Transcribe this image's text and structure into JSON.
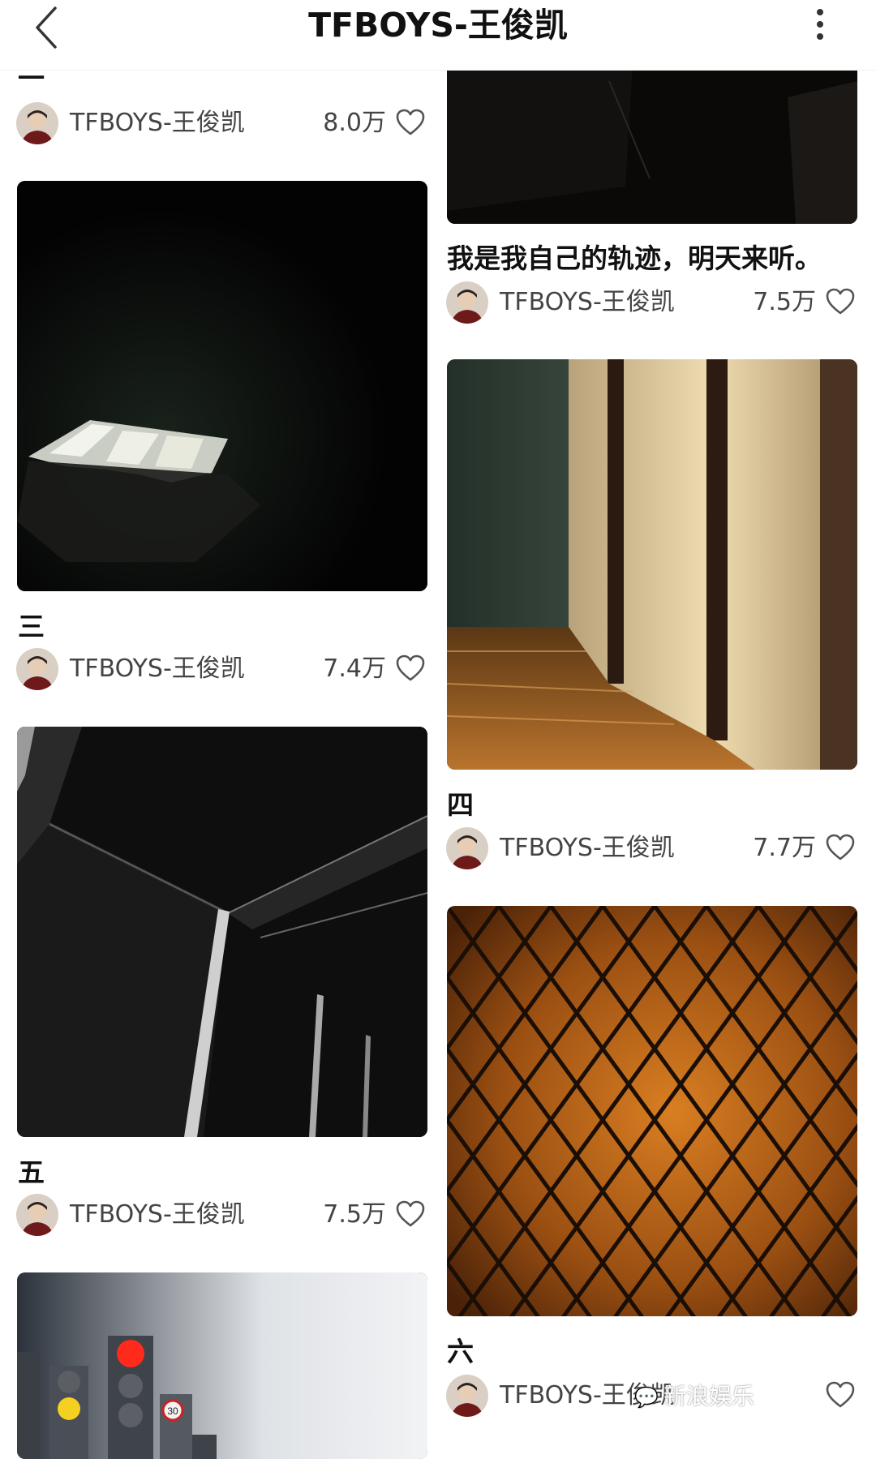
{
  "header": {
    "title": "TFBOYS-王俊凯"
  },
  "posts": [
    {
      "caption": "一",
      "author": "TFBOYS-王俊凯",
      "likes": "8.0万"
    },
    {
      "caption": "我是我自己的轨迹，明天来听。",
      "author": "TFBOYS-王俊凯",
      "likes": "7.5万"
    },
    {
      "caption": "三",
      "author": "TFBOYS-王俊凯",
      "likes": "7.4万"
    },
    {
      "caption": "四",
      "author": "TFBOYS-王俊凯",
      "likes": "7.7万"
    },
    {
      "caption": "五",
      "author": "TFBOYS-王俊凯",
      "likes": "7.5万"
    },
    {
      "caption": "六",
      "author": "TFBOYS-王俊凯",
      "likes": ""
    }
  ],
  "watermark": "新浪娱乐",
  "icons": {
    "back": "chevron-left-icon",
    "more": "more-vertical-icon",
    "like": "heart-outline-icon"
  },
  "colors": {
    "text": "#111111",
    "meta_text": "#444444"
  }
}
